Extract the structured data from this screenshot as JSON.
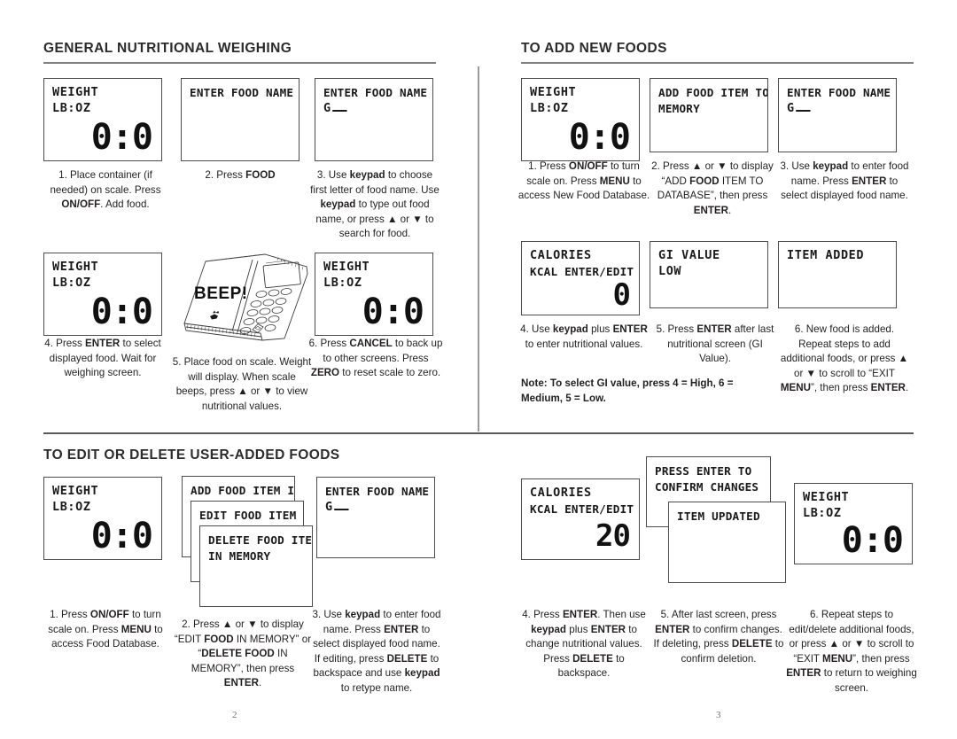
{
  "document": {
    "page_numbers": {
      "left": "2",
      "right": "3"
    }
  },
  "sections": {
    "general_weighing": {
      "title": "GENERAL NUTRITIONAL WEIGHING",
      "screens": {
        "s1": {
          "line1": "WEIGHT",
          "line2": "LB:OZ",
          "big": "0:0"
        },
        "s2": {
          "line1": "ENTER FOOD NAME"
        },
        "s3": {
          "line1": "ENTER FOOD NAME",
          "line2": "G"
        },
        "s4": {
          "line1": "WEIGHT",
          "line2": "LB:OZ",
          "big": "0:0"
        },
        "s6": {
          "line1": "WEIGHT",
          "line2": "LB:OZ",
          "big": "0:0"
        }
      },
      "illustration": {
        "beep_label": "BEEP!"
      },
      "captions": {
        "c1": "1. Place container (if needed) on scale. Press ON/OFF. Add food.",
        "c2": "2. Press FOOD",
        "c3": "3. Use keypad to choose first letter of food name. Use keypad to type out food name, or press ▲ or ▼ to search for food.",
        "c4": "4. Press ENTER to select displayed food. Wait for weighing screen.",
        "c5": "5. Place food on scale. Weight will display. When scale beeps, press ▲ or ▼ to view nutritional values.",
        "c6": "6. Press CANCEL to back up to other screens. Press ZERO to reset scale to zero."
      }
    },
    "add_new_foods": {
      "title": "TO ADD NEW FOODS",
      "screens": {
        "s1": {
          "line1": "WEIGHT",
          "line2": "LB:OZ",
          "big": "0:0"
        },
        "s2": {
          "line1": "ADD FOOD ITEM TO",
          "line2": "MEMORY"
        },
        "s3": {
          "line1": "ENTER FOOD NAME",
          "line2": "G"
        },
        "s4": {
          "line1": "CALORIES",
          "line2": "KCAL ENTER/EDIT",
          "big": "0"
        },
        "s5": {
          "line1": "GI VALUE",
          "line2": "LOW"
        },
        "s6": {
          "line1": "ITEM ADDED"
        }
      },
      "captions": {
        "c1": "1. Press ON/OFF to turn scale on. Press MENU to access New Food Database.",
        "c2": "2. Press ▲ or ▼ to display “ADD FOOD ITEM TO DATABASE”, then press ENTER.",
        "c3": "3. Use keypad to enter food name. Press ENTER to select displayed food name.",
        "c4": "4. Use keypad plus ENTER to enter nutritional values.",
        "c5": "5. Press ENTER after last nutritional screen (GI Value).",
        "c6": "6. New food is added. Repeat steps to add additional foods, or press ▲ or ▼ to scroll to “EXIT MENU”, then press ENTER."
      },
      "note": "Note: To select GI value, press 4 = High, 6 = Medium, 5 = Low."
    },
    "edit_delete_foods": {
      "title": "TO EDIT OR DELETE USER-ADDED FOODS",
      "screens": {
        "s1": {
          "line1": "WEIGHT",
          "line2": "LB:OZ",
          "big": "0:0"
        },
        "s2a": {
          "line1": "ADD FOOD ITEM IN"
        },
        "s2b": {
          "line1": "EDIT FOOD ITEM IN"
        },
        "s2c": {
          "line1": "DELETE FOOD ITEM",
          "line2": "IN MEMORY"
        },
        "s3": {
          "line1": "ENTER FOOD NAME",
          "line2": "G"
        },
        "s4": {
          "line1": "CALORIES",
          "line2": "KCAL ENTER/EDIT",
          "big": "20"
        },
        "s5a": {
          "line1": "PRESS ENTER TO",
          "line2": "CONFIRM CHANGES"
        },
        "s5b": {
          "line1": "ITEM UPDATED"
        },
        "s6": {
          "line1": "WEIGHT",
          "line2": "LB:OZ",
          "big": "0:0"
        }
      },
      "captions": {
        "c1": "1. Press ON/OFF to turn scale on. Press MENU to access Food Database.",
        "c2": "2. Press ▲ or ▼ to display “EDIT FOOD IN MEMORY” or “DELETE FOOD IN MEMORY”, then press ENTER.",
        "c3": "3. Use keypad to enter food name. Press ENTER to select displayed food name. If editing, press DELETE to backspace and use keypad to retype name.",
        "c4": "4. Press ENTER. Then use keypad plus ENTER to change nutritional values. Press DELETE to backspace.",
        "c5": "5. After last screen, press ENTER to confirm changes. If deleting, press DELETE to confirm deletion.",
        "c6": "6. Repeat steps to edit/delete additional foods, or press ▲ or ▼ to scroll to “EXIT MENU”, then press ENTER to return to weighing screen."
      }
    }
  }
}
